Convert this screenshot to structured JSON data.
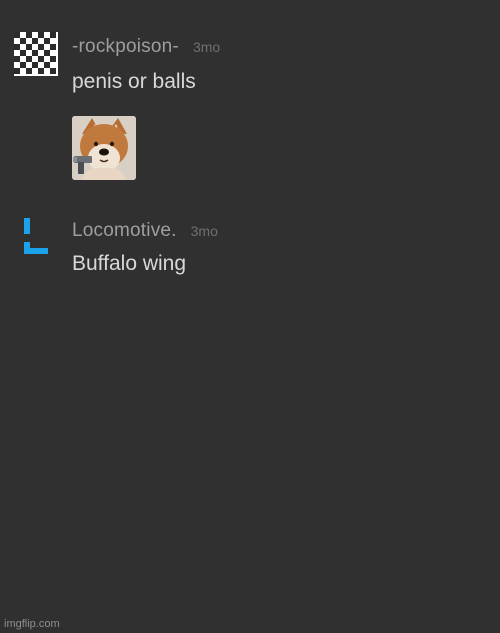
{
  "comments": [
    {
      "username": "-rockpoison-",
      "time": "3mo",
      "text": "penis or balls",
      "avatar_icon": "checkerboard-avatar-icon",
      "attachment": "meme-image-dog-with-gun"
    },
    {
      "username": "Locomotive.",
      "time": "3mo",
      "text": "Buffalo wing",
      "avatar_icon": "blue-l-avatar-icon",
      "avatar_color": "#1aa3e8"
    }
  ],
  "watermark": "imgflip.com",
  "colors": {
    "background": "#303030",
    "username": "#9e9e9e",
    "time": "#6f6f6f",
    "text": "#d8d8d8"
  }
}
